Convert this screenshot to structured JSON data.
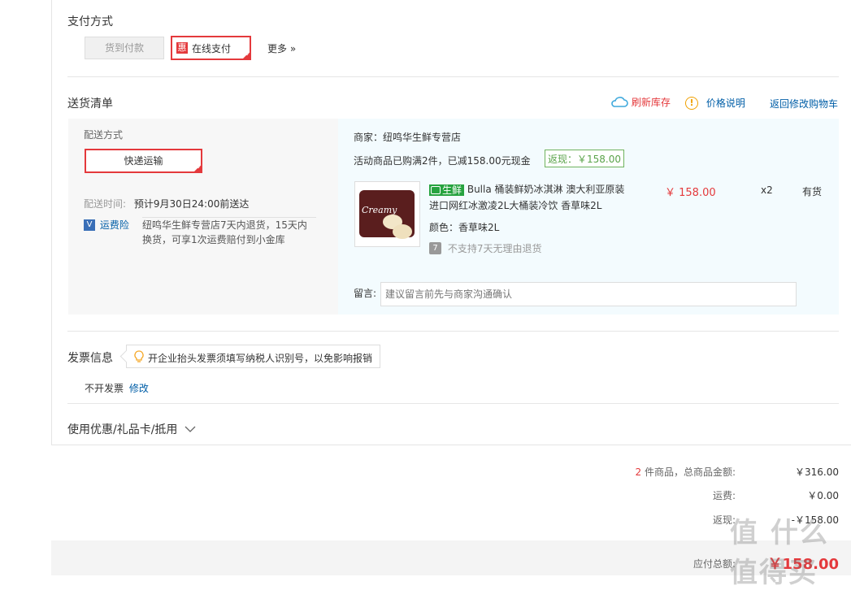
{
  "payment": {
    "title": "支付方式",
    "cod_label": "货到付款",
    "online_badge": "惠",
    "online_label": "在线支付",
    "more_label": "更多 »"
  },
  "delivery": {
    "title": "送货清单",
    "refresh_stock": "刷新库存",
    "price_note": "价格说明",
    "back_to_cart": "返回修改购物车",
    "method_label": "配送方式",
    "method_value": "快递运输",
    "time_label": "配送时间:",
    "time_value": "预计9月30日24:00前送达",
    "insurance_badge": "V",
    "insurance_label": "运费险",
    "insurance_text": "纽鸣华生鲜专营店7天内退货，15天内换货，可享1次运费赔付到小金库"
  },
  "shop": {
    "merchant": "商家：纽鸣华生鲜专营店",
    "promo": "活动商品已购满2件，已减158.00元现金",
    "cashback": "返现：￥158.00"
  },
  "product": {
    "tag": "生鲜",
    "name": "Bulla 桶装鲜奶冰淇淋 澳大利亚原装进口网红冰激凌2L大桶装冷饮 香草味2L",
    "price": "￥ 158.00",
    "qty": "x2",
    "stock": "有货",
    "color": "颜色：香草味2L",
    "return_icon": "7",
    "return_policy": "不支持7天无理由退货",
    "image_text": "Creamy"
  },
  "message": {
    "label": "留言:",
    "placeholder": "建议留言前先与商家沟通确认"
  },
  "invoice": {
    "title": "发票信息",
    "tip": "开企业抬头发票须填写纳税人识别号，以免影响报销",
    "value": "不开发票",
    "edit": "修改"
  },
  "coupon": {
    "label": "使用优惠/礼品卡/抵用"
  },
  "summary": {
    "count": "2",
    "count_suffix": "件商品，总商品金额:",
    "total": "￥316.00",
    "shipping_label": "运费:",
    "shipping": "￥0.00",
    "cashback_label": "返现:",
    "cashback": "-￥158.00",
    "due_label": "应付总额:",
    "due": "￥158.00"
  },
  "watermark": "值 什么值得买"
}
